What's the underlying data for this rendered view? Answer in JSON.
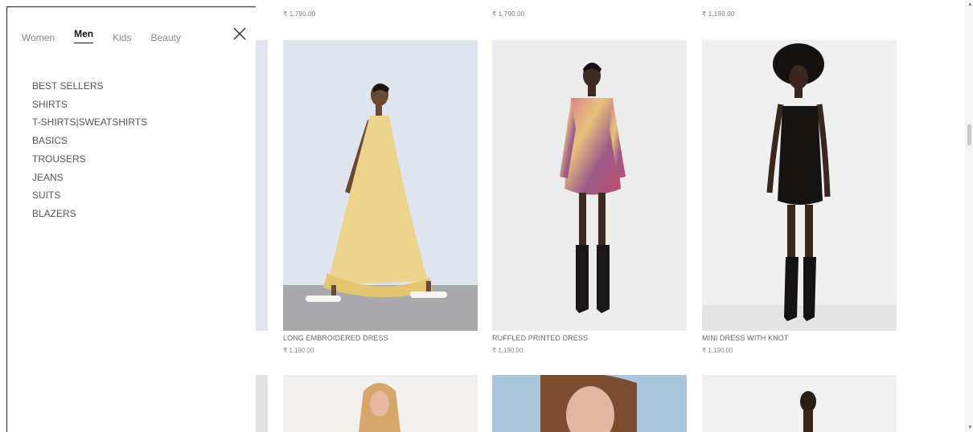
{
  "nav": {
    "tabs": [
      {
        "label": "Women",
        "active": false
      },
      {
        "label": "Men",
        "active": true
      },
      {
        "label": "Kids",
        "active": false
      },
      {
        "label": "Beauty",
        "active": false
      }
    ],
    "close_icon": "close-icon",
    "menu": [
      "BEST SELLERS",
      "SHIRTS",
      "T-SHIRTS|SWEATSHIRTS",
      "BASICS",
      "TROUSERS",
      "JEANS",
      "SUITS",
      "BLAZERS"
    ]
  },
  "top_prices": [
    "₹ 1,790.00",
    "₹ 1,790.00",
    "₹ 1,190.00"
  ],
  "products": [
    {
      "name": "LONG EMBROIDERED DRESS",
      "price": "₹ 1,190.00"
    },
    {
      "name": "RUFFLED PRINTED DRESS",
      "price": "₹ 1,190.00"
    },
    {
      "name": "MINI DRESS WITH KNOT",
      "price": "₹ 1,190.00"
    }
  ],
  "colors": {
    "accent": "#111111",
    "muted": "#888888"
  }
}
